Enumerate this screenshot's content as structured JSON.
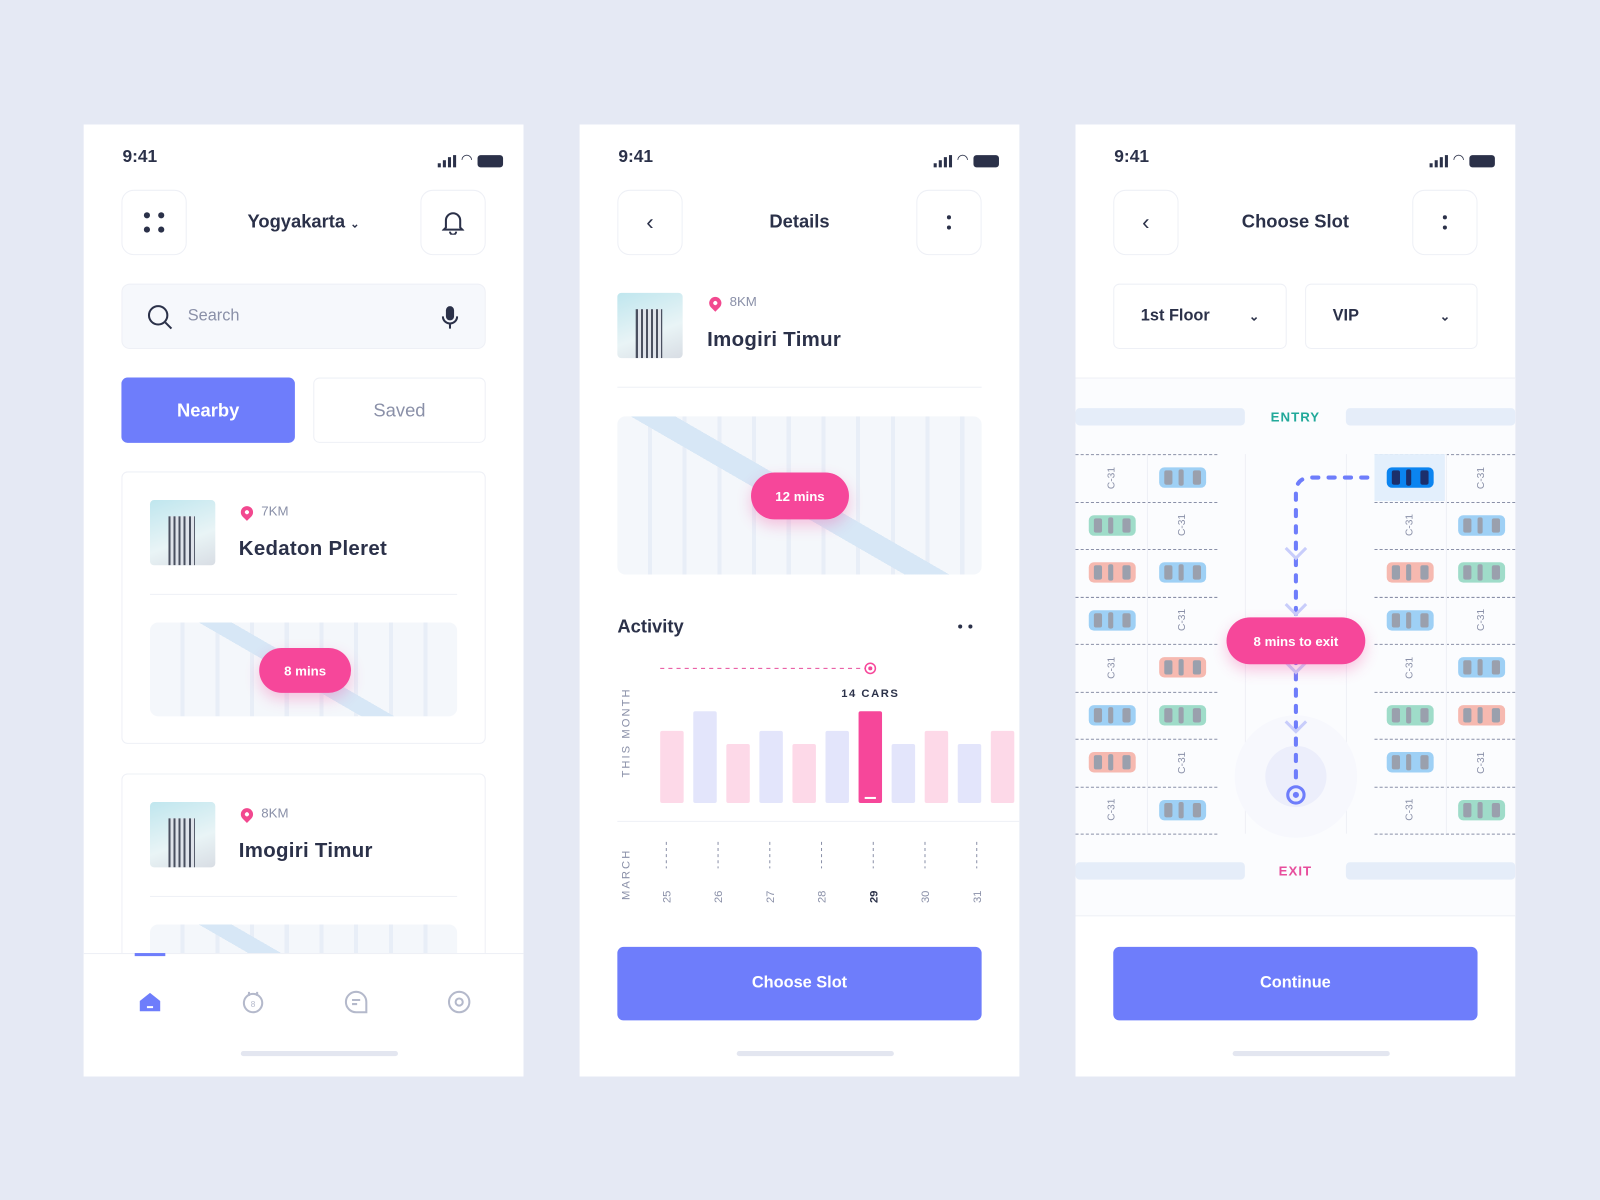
{
  "status": {
    "time": "9:41"
  },
  "screen1": {
    "location": "Yogyakarta",
    "search_placeholder": "Search",
    "tabs": [
      {
        "label": "Nearby",
        "active": true
      },
      {
        "label": "Saved",
        "active": false
      }
    ],
    "places": [
      {
        "distance": "7KM",
        "name": "Kedaton Pleret",
        "eta": "8 mins"
      },
      {
        "distance": "8KM",
        "name": "Imogiri Timur",
        "eta": ""
      }
    ],
    "nav": [
      {
        "icon": "home-icon",
        "active": true
      },
      {
        "icon": "calendar-icon",
        "badge": "8"
      },
      {
        "icon": "chat-icon"
      },
      {
        "icon": "settings-icon"
      }
    ]
  },
  "screen2": {
    "title": "Details",
    "place": {
      "distance": "8KM",
      "name": "Imogiri Timur",
      "eta": "12 mins"
    },
    "activity_title": "Activity",
    "button": "Choose Slot",
    "chart_data": {
      "type": "bar",
      "ylabel": "THIS MONTH",
      "xlabel": "MARCH",
      "tick_labels": [
        "25",
        "26",
        "27",
        "28",
        "29",
        "30",
        "31"
      ],
      "selected_tick": "29",
      "values": [
        11,
        14,
        9,
        11,
        9,
        11,
        14,
        9,
        11,
        9,
        11
      ],
      "highlight_index": 6,
      "highlight_label": "14 CARS",
      "colors": {
        "pink": "#fdd9e8",
        "lavender": "#e3e5fb",
        "highlight": "#f6479a"
      }
    }
  },
  "screen3": {
    "title": "Choose Slot",
    "floor": "1st Floor",
    "type": "VIP",
    "entry": "ENTRY",
    "exit": "EXIT",
    "eta": "8 mins to exit",
    "slot_label": "C-31",
    "columns": [
      [
        "label",
        "green",
        "red",
        "blue",
        "label",
        "blue",
        "red",
        "label"
      ],
      [
        "blue",
        "label",
        "blue",
        "label",
        "red",
        "green",
        "label",
        "blue"
      ],
      [
        "selected",
        "label",
        "red",
        "blue",
        "label",
        "green",
        "blue",
        "label"
      ],
      [
        "label",
        "blue",
        "green",
        "label",
        "blue",
        "red",
        "label",
        "green"
      ]
    ],
    "button": "Continue"
  },
  "colors": {
    "accent": "#6e7dfb",
    "pink": "#f6479a",
    "entry": "#22a99a",
    "exit": "#e74d9c",
    "blue_car": "#9ed0f5",
    "green_car": "#9fdcc9",
    "red_car": "#f6b9b0",
    "selected_car": "#0b84f0"
  }
}
